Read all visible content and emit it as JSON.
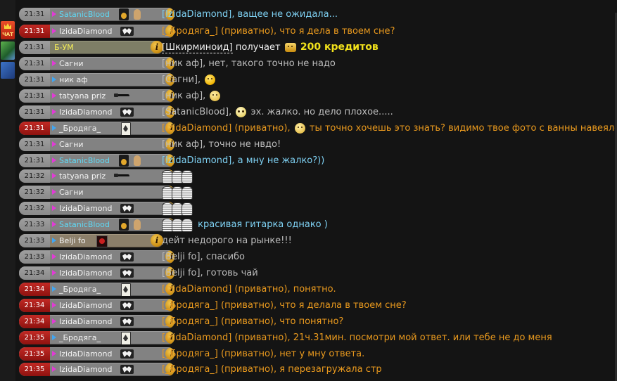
{
  "colors": {
    "background": "#141414",
    "private_time": "#c22a25",
    "private_text": "#ea9a1e",
    "credits": "#f2e21b",
    "nick_magenta_marker": "#e23ad6",
    "nick_blue_marker": "#41a6f2"
  },
  "left_strip": {
    "chat_label": "ЧАТ"
  },
  "messages": [
    {
      "time": "21:31",
      "nick": "SatanicBlood",
      "text": "[IzidaDiamond], ващее не ожидала...",
      "private": false
    },
    {
      "time": "21:31",
      "nick": "IzidaDiamond",
      "text": "[_Бродяга_] (приватно), что я дела в твоем сне?",
      "private": true
    },
    {
      "time": "21:31",
      "nick": "Б-УМ",
      "text_parts": {
        "name": "[Шкирминоид]",
        "verb": "получает",
        "amount": "200 кредитов"
      },
      "private": false
    },
    {
      "time": "21:31",
      "nick": "Сагни",
      "text": "[ник аф], нет, такого точно не надо",
      "private": false
    },
    {
      "time": "21:31",
      "nick": "ник аф",
      "text": "[Сагни],",
      "private": false
    },
    {
      "time": "21:31",
      "nick": "tatyana priz",
      "text": "[ник аф],",
      "private": false
    },
    {
      "time": "21:31",
      "nick": "IzidaDiamond",
      "text": "[SatanicBlood],",
      "text2": "эх. жалко. но дело плохое.....",
      "private": false
    },
    {
      "time": "21:31",
      "nick": "_Бродяга_",
      "text": "[IzidaDiamond] (приватно),",
      "text2": "ты точно хочешь это знать? видимо твое фото с ванны навеяло..",
      "private": true
    },
    {
      "time": "21:31",
      "nick": "Сагни",
      "text": "[ник аф], точно не нвдо!",
      "private": false
    },
    {
      "time": "21:31",
      "nick": "SatanicBlood",
      "text": "[IzidaDiamond], а мну не жалко?))",
      "private": false
    },
    {
      "time": "21:32",
      "nick": "tatyana priz",
      "text": "",
      "private": false
    },
    {
      "time": "21:32",
      "nick": "Сагни",
      "text": "",
      "private": false
    },
    {
      "time": "21:32",
      "nick": "IzidaDiamond",
      "text": "",
      "private": false
    },
    {
      "time": "21:33",
      "nick": "SatanicBlood",
      "text": "красивая гитарка однако )",
      "private": false
    },
    {
      "time": "21:33",
      "nick": "Belji fo",
      "text": "дейт недорого на рынке!!!",
      "private": false
    },
    {
      "time": "21:33",
      "nick": "IzidaDiamond",
      "text": "[Belji fo], спасибо",
      "private": false
    },
    {
      "time": "21:34",
      "nick": "IzidaDiamond",
      "text": "[Belji fo], готовь чай",
      "private": false
    },
    {
      "time": "21:34",
      "nick": "_Бродяга_",
      "text": "[IzidaDiamond] (приватно), понятно.",
      "private": true
    },
    {
      "time": "21:34",
      "nick": "IzidaDiamond",
      "text": "[_Бродяга_] (приватно), что я делала в твоем сне?",
      "private": true
    },
    {
      "time": "21:34",
      "nick": "IzidaDiamond",
      "text": "[_Бродяга_] (приватно), что понятно?",
      "private": true
    },
    {
      "time": "21:35",
      "nick": "_Бродяга_",
      "text": "[IzidaDiamond] (приватно), 21ч.31мин. посмотри мой ответ. или тебе не до меня",
      "private": true
    },
    {
      "time": "21:35",
      "nick": "IzidaDiamond",
      "text": "[_Бродяга_] (приватно), нет у мну ответа.",
      "private": true
    },
    {
      "time": "21:35",
      "nick": "IzidaDiamond",
      "text": "[_Бродяга_] (приватно), я перезагружала стр",
      "private": true
    }
  ]
}
